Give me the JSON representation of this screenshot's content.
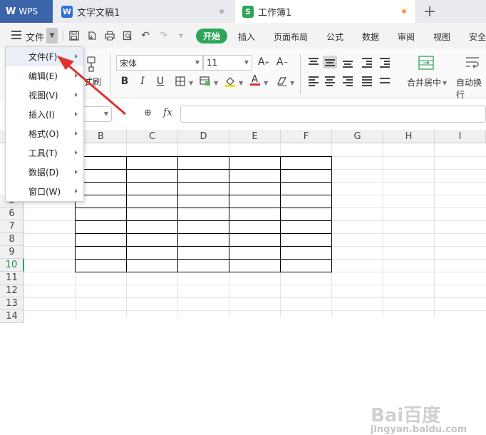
{
  "tabs": {
    "wps_label": "WPS",
    "doc_title": "文字文稿1",
    "sheet_title": "工作簿1",
    "new_tab": "+"
  },
  "menubar": {
    "file_label": "文件",
    "start_label": "开始",
    "ribbon_tabs": [
      "插入",
      "页面布局",
      "公式",
      "数据",
      "审阅",
      "视图",
      "安全"
    ]
  },
  "ribbon": {
    "format_painter_label": "式刷",
    "font_name": "宋体",
    "font_size": "11",
    "merge_label": "合并居中",
    "wrap_label": "自动换行"
  },
  "formula_bar": {
    "fx_label": "fx"
  },
  "grid": {
    "columns": [
      "B",
      "C",
      "D",
      "E",
      "F",
      "G",
      "H",
      "I"
    ],
    "rows": [
      "5",
      "6",
      "7",
      "8",
      "9",
      "10",
      "11",
      "12",
      "13",
      "14"
    ],
    "active_row": "10"
  },
  "file_menu": {
    "items": [
      "文件(F)",
      "编辑(E)",
      "视图(V)",
      "插入(I)",
      "格式(O)",
      "工具(T)",
      "数据(D)",
      "窗口(W)"
    ]
  },
  "watermark": {
    "brand": "Bai百度",
    "sub": "jingyan.baidu.com"
  },
  "colors": {
    "wps_blue": "#3c64a8",
    "doc_blue": "#2f6fd6",
    "sheet_green": "#2ca55b",
    "arrow_red": "#e0322e"
  }
}
